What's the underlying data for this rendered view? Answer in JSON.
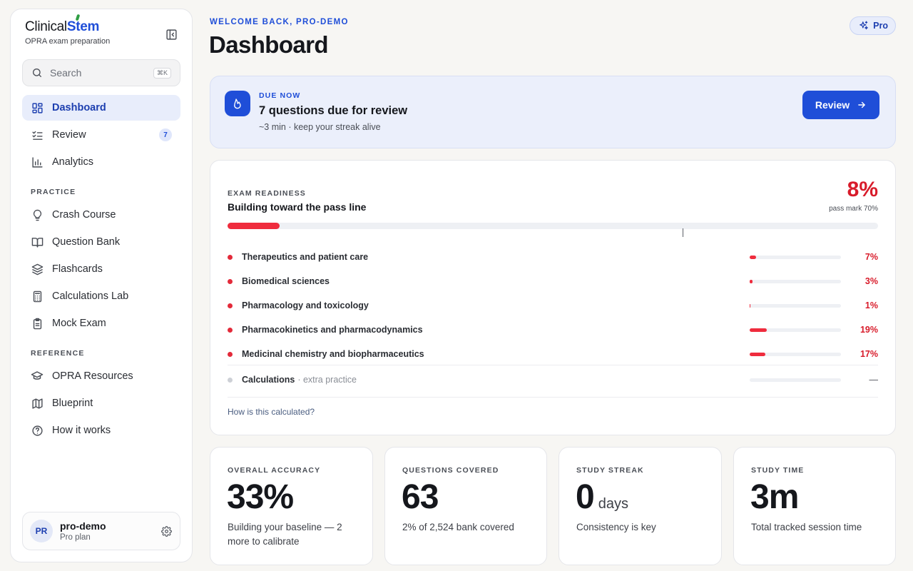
{
  "brand": {
    "name_part1": "Clinical",
    "name_part2": "Stem",
    "subtitle": "OPRA exam preparation"
  },
  "search": {
    "placeholder": "Search",
    "shortcut": "⌘K"
  },
  "nav": {
    "main": [
      {
        "label": "Dashboard",
        "icon": "grid-icon",
        "active": true
      },
      {
        "label": "Review",
        "icon": "checklist-icon",
        "badge": "7"
      },
      {
        "label": "Analytics",
        "icon": "bar-chart-icon"
      }
    ],
    "practice_heading": "PRACTICE",
    "practice": [
      {
        "label": "Crash Course",
        "icon": "lightbulb-icon"
      },
      {
        "label": "Question Bank",
        "icon": "book-open-icon"
      },
      {
        "label": "Flashcards",
        "icon": "layers-icon"
      },
      {
        "label": "Calculations Lab",
        "icon": "calculator-icon"
      },
      {
        "label": "Mock Exam",
        "icon": "clipboard-icon"
      }
    ],
    "reference_heading": "REFERENCE",
    "reference": [
      {
        "label": "OPRA Resources",
        "icon": "graduation-cap-icon"
      },
      {
        "label": "Blueprint",
        "icon": "map-icon"
      },
      {
        "label": "How it works",
        "icon": "help-circle-icon"
      }
    ]
  },
  "user": {
    "initials": "PR",
    "name": "pro-demo",
    "plan": "Pro plan"
  },
  "header": {
    "welcome": "WELCOME BACK, PRO-DEMO",
    "title": "Dashboard",
    "pro_label": "Pro"
  },
  "due": {
    "label": "DUE NOW",
    "title": "7 questions due for review",
    "subtitle": "~3 min · keep your streak alive",
    "button": "Review"
  },
  "readiness": {
    "label": "EXAM READINESS",
    "title": "Building toward the pass line",
    "percent_text": "8%",
    "percent": 8,
    "pass_text": "pass mark 70%",
    "pass_mark": 70,
    "topics": [
      {
        "name": "Therapeutics and patient care",
        "percent": 7,
        "percent_text": "7%"
      },
      {
        "name": "Biomedical sciences",
        "percent": 3,
        "percent_text": "3%"
      },
      {
        "name": "Pharmacology and toxicology",
        "percent": 1,
        "percent_text": "1%"
      },
      {
        "name": "Pharmacokinetics and pharmacodynamics",
        "percent": 19,
        "percent_text": "19%"
      },
      {
        "name": "Medicinal chemistry and biopharmaceutics",
        "percent": 17,
        "percent_text": "17%"
      }
    ],
    "calc": {
      "name": "Calculations",
      "extra": "· extra practice",
      "value": "—"
    },
    "how_link": "How is this calculated?"
  },
  "stats": [
    {
      "label": "OVERALL ACCURACY",
      "value": "33%",
      "unit": "",
      "desc": "Building your baseline — 2 more to calibrate"
    },
    {
      "label": "QUESTIONS COVERED",
      "value": "63",
      "unit": "",
      "desc": "2% of 2,524 bank covered"
    },
    {
      "label": "STUDY STREAK",
      "value": "0",
      "unit": "days",
      "desc": "Consistency is key"
    },
    {
      "label": "STUDY TIME",
      "value": "3m",
      "unit": "",
      "desc": "Total tracked session time"
    }
  ],
  "colors": {
    "accent": "#1f4ed8",
    "danger": "#ef2c3d",
    "background": "#f7f6f3"
  }
}
